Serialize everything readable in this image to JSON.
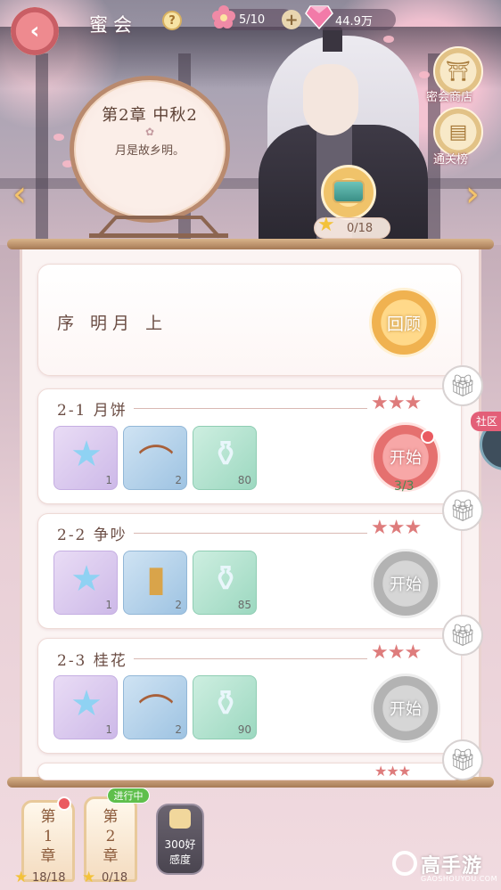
{
  "header": {
    "title": "蜜会",
    "help": "?",
    "flower_count": "5/10",
    "plus": "+",
    "gem_count": "44.9万"
  },
  "side_buttons": {
    "shop_label": "密会商店",
    "ranking_label": "通关榜"
  },
  "chapter": {
    "title": "第2章  中秋2",
    "ornament": "✿",
    "description": "月是故乡明。",
    "star_progress": "0/18"
  },
  "prologue": {
    "label": "序 明月 上",
    "review_label": "回顾"
  },
  "levels": [
    {
      "title": "2-1 月饼",
      "stars": "★★★",
      "items": [
        {
          "icon": "star-crystal-icon",
          "count": "1"
        },
        {
          "icon": "comb-icon",
          "count": "2"
        },
        {
          "icon": "potion-bottle-icon",
          "count": "80"
        }
      ],
      "start_label": "开始",
      "attempts": "3/3"
    },
    {
      "title": "2-2 争吵",
      "stars": "★★★",
      "items": [
        {
          "icon": "star-crystal-icon",
          "count": "1"
        },
        {
          "icon": "golden-plaque-icon",
          "count": "2"
        },
        {
          "icon": "potion-bottle-icon",
          "count": "85"
        }
      ],
      "start_label": "开始"
    },
    {
      "title": "2-3 桂花",
      "stars": "★★★",
      "items": [
        {
          "icon": "star-crystal-icon",
          "count": "1"
        },
        {
          "icon": "comb-icon",
          "count": "2"
        },
        {
          "icon": "potion-bottle-icon",
          "count": "90"
        }
      ],
      "start_label": "开始"
    }
  ],
  "fourth_level_stars": "★★★",
  "community_label": "社区",
  "tabs": [
    {
      "label_line1": "第",
      "label_line2": "1",
      "label_line3": "章",
      "stars": "18/18"
    },
    {
      "label_line1": "第",
      "label_line2": "2",
      "label_line3": "章",
      "stars": "0/18",
      "badge": "进行中"
    }
  ],
  "favor": {
    "line1": "300好",
    "line2": "感度"
  },
  "watermark": {
    "title": "高手游",
    "subtitle": "GAOSHOUYOU.COM"
  },
  "colors": {
    "accent_pink": "#e5706f",
    "star_red": "#de7c7c",
    "gold": "#f3c23a",
    "in_progress_green": "#5fbf4c"
  }
}
